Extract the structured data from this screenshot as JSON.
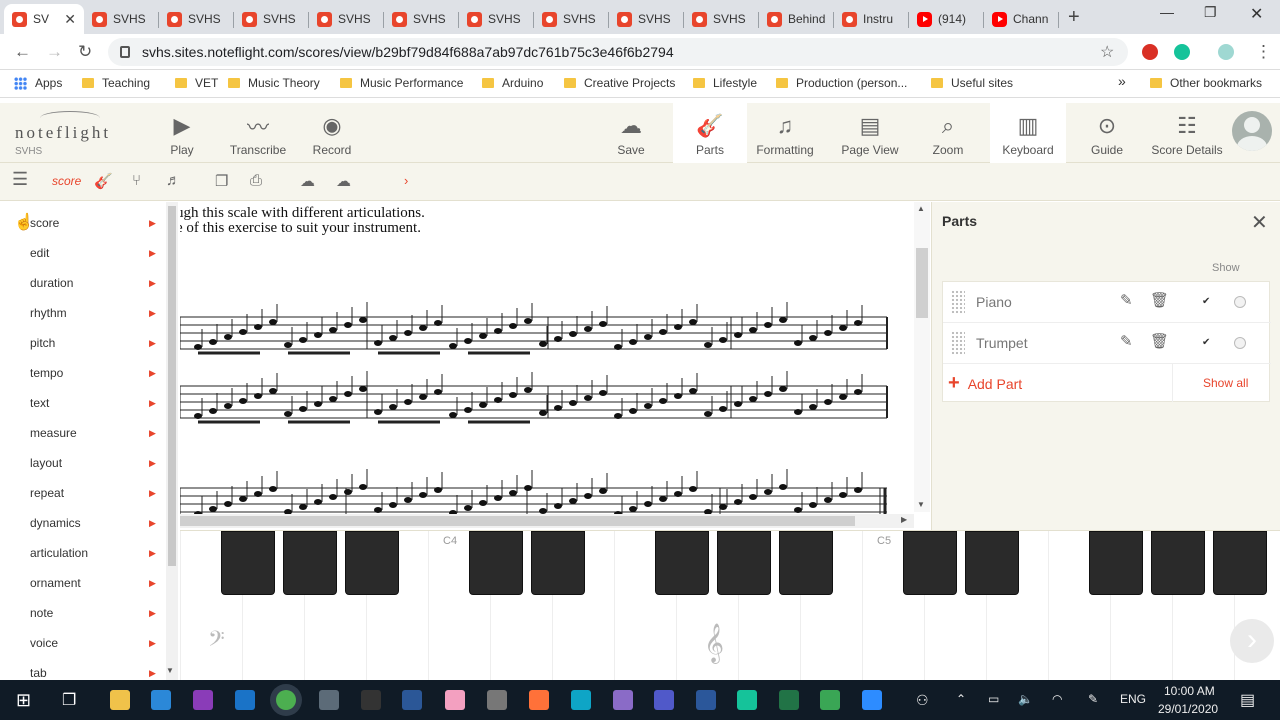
{
  "browser": {
    "tabs": [
      {
        "title": "SV",
        "icon": "noteflight",
        "active": true
      },
      {
        "title": "SVHS",
        "icon": "noteflight"
      },
      {
        "title": "SVHS",
        "icon": "noteflight"
      },
      {
        "title": "SVHS",
        "icon": "noteflight"
      },
      {
        "title": "SVHS",
        "icon": "noteflight"
      },
      {
        "title": "SVHS",
        "icon": "noteflight"
      },
      {
        "title": "SVHS",
        "icon": "noteflight"
      },
      {
        "title": "SVHS",
        "icon": "noteflight"
      },
      {
        "title": "SVHS",
        "icon": "noteflight"
      },
      {
        "title": "SVHS",
        "icon": "noteflight"
      },
      {
        "title": "Behind",
        "icon": "noteflight"
      },
      {
        "title": "Instru",
        "icon": "noteflight"
      },
      {
        "title": "(914)",
        "icon": "youtube"
      },
      {
        "title": "Chann",
        "icon": "youtube"
      }
    ],
    "url": "svhs.sites.noteflight.com/scores/view/b29bf79d84f688a7ab97dc761b75c3e46f6b2794",
    "bookmarks": [
      {
        "label": "Apps",
        "icon": "apps-grid"
      },
      {
        "label": "Teaching",
        "icon": "folder"
      },
      {
        "label": "VET",
        "icon": "folder"
      },
      {
        "label": "Music Theory",
        "icon": "folder"
      },
      {
        "label": "Music Performance",
        "icon": "folder"
      },
      {
        "label": "Arduino",
        "icon": "folder"
      },
      {
        "label": "Creative Projects",
        "icon": "folder"
      },
      {
        "label": "Lifestyle",
        "icon": "folder"
      },
      {
        "label": "Production (person...",
        "icon": "folder"
      },
      {
        "label": "Useful sites",
        "icon": "folder"
      }
    ],
    "bookmarks_more": "»",
    "other_bookmarks": "Other bookmarks"
  },
  "app": {
    "logo": "noteflight",
    "site": "SVHS",
    "toolbar_left": [
      {
        "label": "Play",
        "icon": "play-icon"
      },
      {
        "label": "Transcribe",
        "icon": "transcribe-icon"
      },
      {
        "label": "Record",
        "icon": "record-icon"
      }
    ],
    "toolbar_right": [
      {
        "label": "Save",
        "icon": "cloud-upload-icon"
      },
      {
        "label": "Parts",
        "icon": "guitar-icon",
        "selected": true
      },
      {
        "label": "Formatting",
        "icon": "formatting-icon"
      },
      {
        "label": "Page View",
        "icon": "page-icon"
      },
      {
        "label": "Zoom",
        "icon": "zoom-icon"
      },
      {
        "label": "Keyboard",
        "icon": "keyboard-icon",
        "selected": true
      },
      {
        "label": "Guide",
        "icon": "guide-icon"
      },
      {
        "label": "Score Details",
        "icon": "details-icon"
      }
    ],
    "subbar_mode": "score"
  },
  "menu": {
    "items": [
      "score",
      "edit",
      "duration",
      "rhythm",
      "pitch",
      "tempo",
      "text",
      "measure",
      "layout",
      "repeat",
      "dynamics",
      "articulation",
      "ornament",
      "note",
      "voice",
      "tab"
    ]
  },
  "score": {
    "text_line1": "ugh this scale with different articulations.",
    "text_line2": "e of this exercise to suit your instrument."
  },
  "parts_panel": {
    "title": "Parts",
    "show_label": "Show",
    "parts": [
      {
        "name": "Piano",
        "shown": true
      },
      {
        "name": "Trumpet",
        "shown": true
      }
    ],
    "add_label": "Add Part",
    "show_all_label": "Show all"
  },
  "keyboard": {
    "labels": [
      "C4",
      "C5"
    ]
  },
  "taskbar": {
    "lang": "ENG",
    "time": "10:00 AM",
    "date": "29/01/2020"
  }
}
